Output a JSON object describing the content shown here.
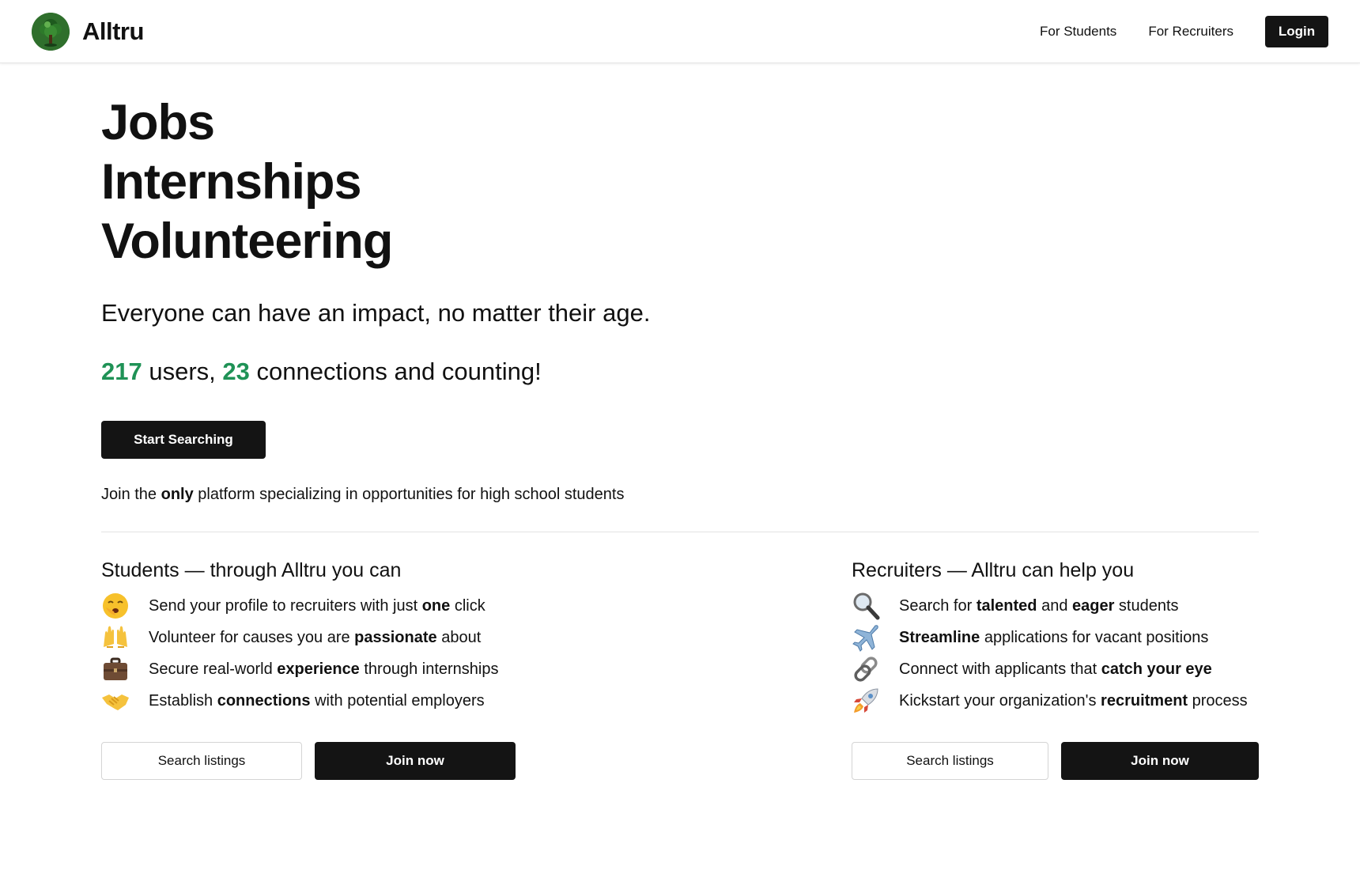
{
  "header": {
    "brand": "Alltru",
    "logo_icon": "tree-icon",
    "nav": [
      "For Students",
      "For Recruiters"
    ],
    "login_label": "Login"
  },
  "hero": {
    "lines": [
      "Jobs",
      "Internships",
      "Volunteering"
    ],
    "tagline": "Everyone can have an impact, no matter their age.",
    "stats": {
      "users": "217",
      "users_suffix": " users, ",
      "connections": "23",
      "connections_suffix": " connections and counting!"
    },
    "cta_label": "Start Searching",
    "join_line": {
      "before": "Join the ",
      "bold": "only",
      "after": " platform specializing in opportunities for high school students"
    }
  },
  "students": {
    "title": "Students — through Alltru you can",
    "features": [
      {
        "icon": "yawning-face-icon",
        "before": "Send your profile to recruiters with just ",
        "bold": "one",
        "after": " click"
      },
      {
        "icon": "raised-hands-icon",
        "before": "Volunteer for causes you are ",
        "bold": "passionate",
        "after": " about"
      },
      {
        "icon": "briefcase-icon",
        "before": "Secure real-world ",
        "bold": "experience",
        "after": " through internships"
      },
      {
        "icon": "handshake-icon",
        "before": "Establish ",
        "bold": "connections",
        "after": " with potential employers"
      }
    ],
    "search_label": "Search listings",
    "join_label": "Join now"
  },
  "recruiters": {
    "title": "Recruiters — Alltru can help you",
    "features": [
      {
        "icon": "magnifying-glass-icon",
        "before": "Search for ",
        "bold": "talented",
        "middle": " and ",
        "bold2": "eager",
        "after": " students"
      },
      {
        "icon": "airplane-icon",
        "before": "",
        "bold": "Streamline",
        "after": " applications for vacant positions"
      },
      {
        "icon": "link-icon",
        "before": "Connect with applicants that ",
        "bold": "catch your eye",
        "after": ""
      },
      {
        "icon": "rocket-icon",
        "before": "Kickstart your organization's ",
        "bold": "recruitment",
        "after": " process"
      }
    ],
    "search_label": "Search listings",
    "join_label": "Join now"
  },
  "colors": {
    "accent_green": "#1f9256",
    "button_dark": "#141414"
  }
}
